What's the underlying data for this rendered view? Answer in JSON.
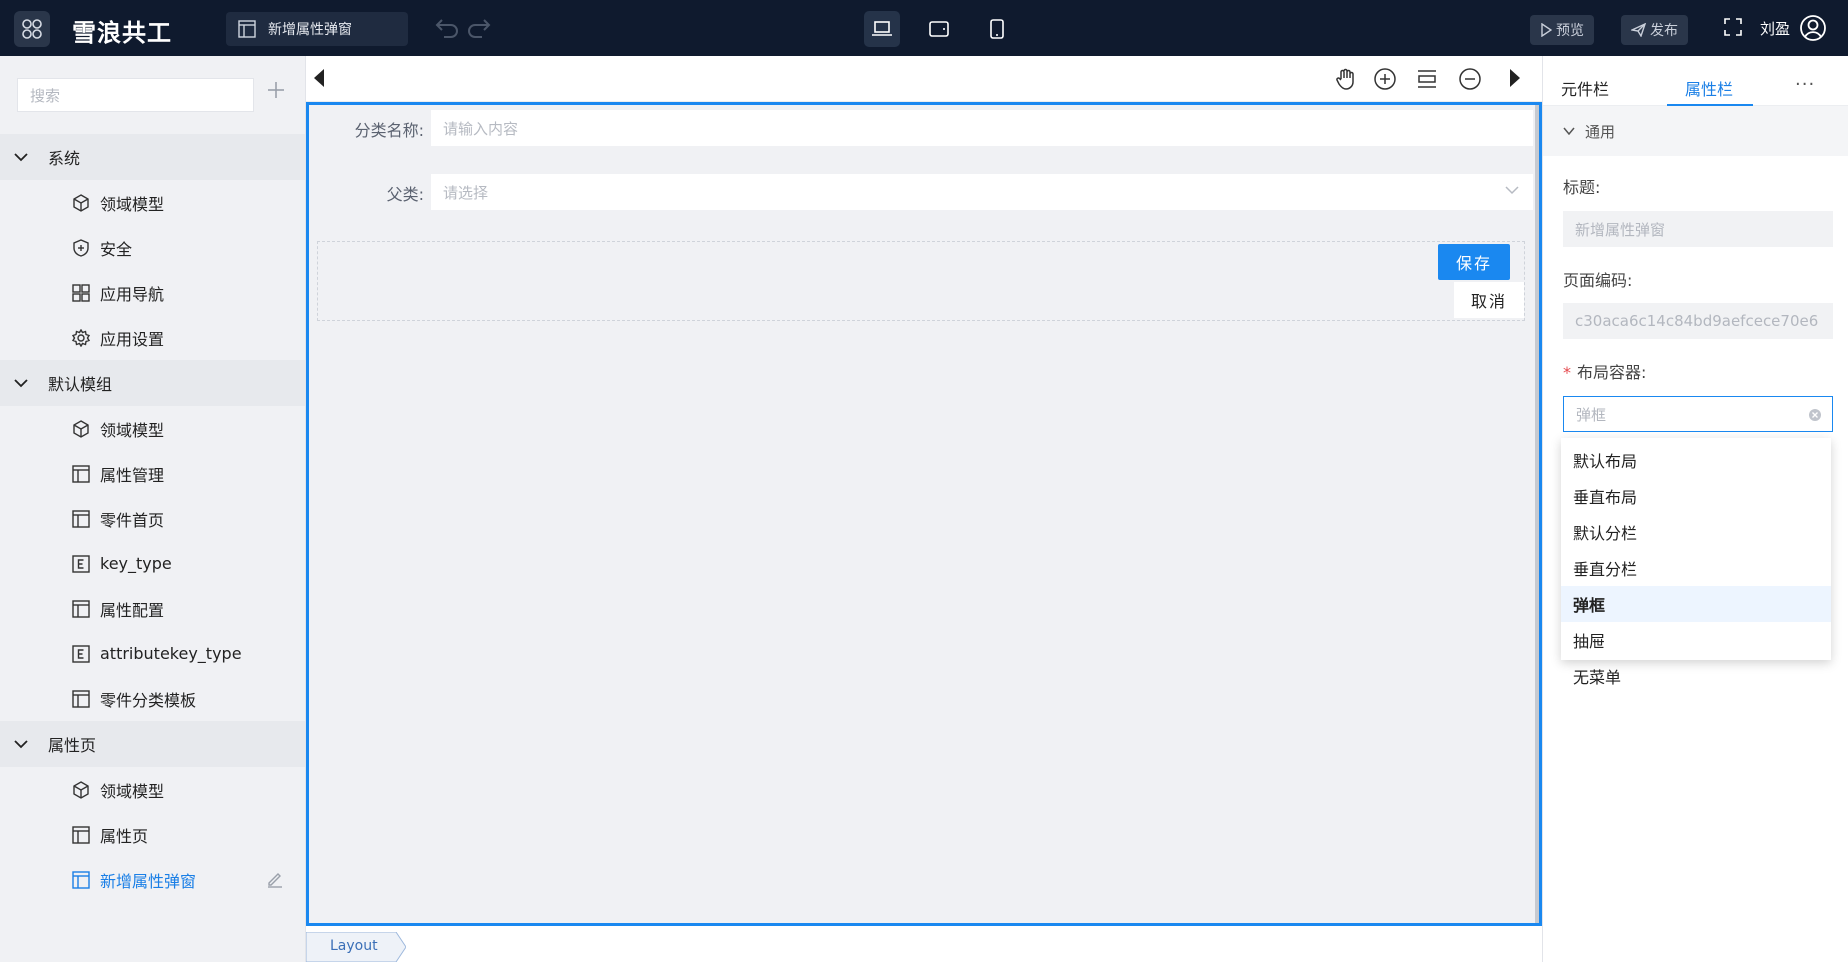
{
  "header": {
    "app_name": "雪浪共工",
    "page_chip_label": "新增属性弹窗",
    "preview_label": "预览",
    "publish_label": "发布",
    "user_name": "刘盈"
  },
  "sidebar": {
    "search_placeholder": "搜索",
    "groups": [
      {
        "label": "系统",
        "items": [
          {
            "label": "领域模型",
            "icon": "cube-icon"
          },
          {
            "label": "安全",
            "icon": "shield-icon"
          },
          {
            "label": "应用导航",
            "icon": "grid-icon"
          },
          {
            "label": "应用设置",
            "icon": "gear-icon"
          }
        ]
      },
      {
        "label": "默认模组",
        "items": [
          {
            "label": "领域模型",
            "icon": "cube-icon"
          },
          {
            "label": "属性管理",
            "icon": "page-layout-icon"
          },
          {
            "label": "零件首页",
            "icon": "page-layout-icon"
          },
          {
            "label": "key_type",
            "icon": "enum-icon"
          },
          {
            "label": "属性配置",
            "icon": "page-layout-icon"
          },
          {
            "label": "attributekey_type",
            "icon": "enum-icon"
          },
          {
            "label": "零件分类模板",
            "icon": "page-layout-icon"
          }
        ]
      },
      {
        "label": "属性页",
        "items": [
          {
            "label": "领域模型",
            "icon": "cube-icon"
          },
          {
            "label": "属性页",
            "icon": "page-layout-icon"
          },
          {
            "label": "新增属性弹窗",
            "icon": "page-layout-icon",
            "selected": true
          }
        ]
      }
    ]
  },
  "canvas": {
    "fields": [
      {
        "label": "分类名称:",
        "placeholder": "请输入内容"
      },
      {
        "label": "父类:",
        "placeholder": "请选择"
      }
    ],
    "save_label": "保存",
    "cancel_label": "取消",
    "layout_tab": "Layout"
  },
  "right_panel": {
    "tabs": [
      "元件栏",
      "属性栏"
    ],
    "active_tab": "属性栏",
    "section": "通用",
    "title_label": "标题:",
    "title_value": "新增属性弹窗",
    "page_code_label": "页面编码:",
    "page_code_value": "c30aca6c14c84bd9aefcece70e6",
    "layout_label": "布局容器:",
    "layout_placeholder": "弹框",
    "layout_options": [
      "默认布局",
      "垂直布局",
      "默认分栏",
      "垂直分栏",
      "弹框",
      "抽屉",
      "无菜单"
    ],
    "layout_selected": "弹框"
  },
  "colors": {
    "topbar_bg": "#0f1a2e",
    "accent": "#1a88f0",
    "sidebar_bg": "#f0f1f4"
  }
}
